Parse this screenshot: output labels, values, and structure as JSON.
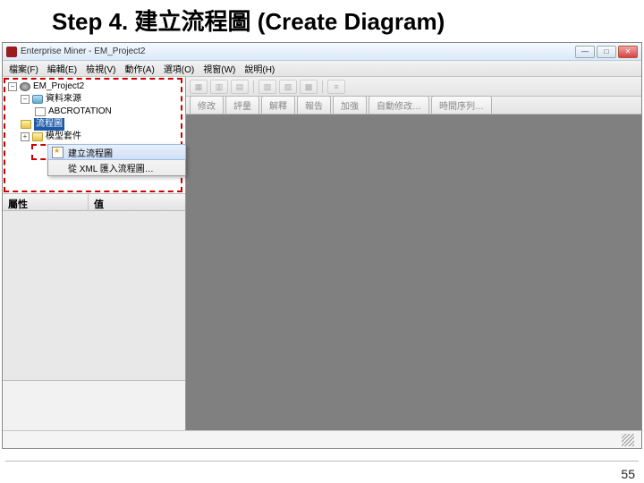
{
  "slide": {
    "title_prefix": "Step 4. ",
    "title_cjk": "建立流程圖",
    "title_suffix": " (Create Diagram)",
    "page_number": "55"
  },
  "window": {
    "title": "Enterprise Miner - EM_Project2",
    "min_tip": "—",
    "max_tip": "□",
    "close_tip": "✕"
  },
  "menu": {
    "file": "檔案(F)",
    "edit": "編輯(E)",
    "view": "檢視(V)",
    "actions": "動作(A)",
    "options": "選項(O)",
    "window": "視窗(W)",
    "help": "說明(H)"
  },
  "tree": {
    "root": "EM_Project2",
    "datasources": "資料來源",
    "ds1": "ABCROTATION",
    "diagrams": "流程圖",
    "model_pkg": "模型套件"
  },
  "context_menu": {
    "create_diagram": "建立流程圖",
    "import_xml": "從 XML 匯入流程圖…"
  },
  "properties": {
    "col_attr": "屬性",
    "col_value": "值"
  },
  "toolbar": {
    "btns": [
      "▦",
      "▥",
      "▤",
      "▧",
      "▨",
      "▩",
      "≡"
    ]
  },
  "tabs": {
    "items": [
      "修改",
      "評量",
      "解釋",
      "報告",
      "加強",
      "自動修改…",
      "時間序列…"
    ]
  }
}
